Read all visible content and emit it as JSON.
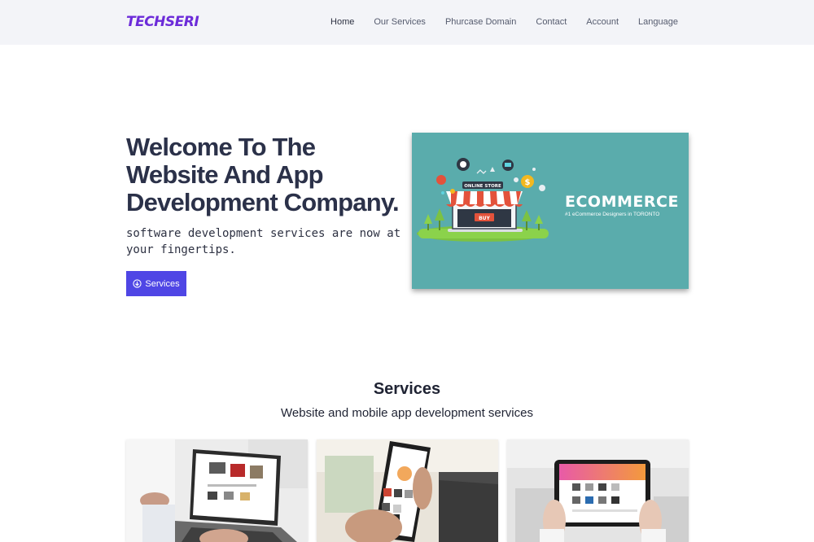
{
  "brand": {
    "logo_text": "TECHSERI",
    "accent": "#4f46e5",
    "logo_color": "#6c2bd9"
  },
  "nav": {
    "items": [
      {
        "label": "Home"
      },
      {
        "label": "Our Services"
      },
      {
        "label": "Phurcase Domain"
      },
      {
        "label": "Contact"
      },
      {
        "label": "Account"
      },
      {
        "label": "Language"
      }
    ]
  },
  "hero": {
    "title": "Welcome To The Website And App Development Company.",
    "subtitle": "software development services are now at your fingertips.",
    "button_label": "Services",
    "button_icon": "arrow-circle-down-icon",
    "banner": {
      "title": "ECOMMERCE",
      "subtitle": "#1 eCommerce Designers in TORONTO",
      "store_sign": "ONLINE STORE",
      "buy_label": "BUY",
      "background": "#5aacac"
    }
  },
  "services": {
    "title": "Services",
    "subtitle": "Website and mobile app development services",
    "cards": [
      {
        "name": "laptop-ecommerce-photo"
      },
      {
        "name": "phone-shopping-photo"
      },
      {
        "name": "tablet-store-photo"
      }
    ]
  }
}
